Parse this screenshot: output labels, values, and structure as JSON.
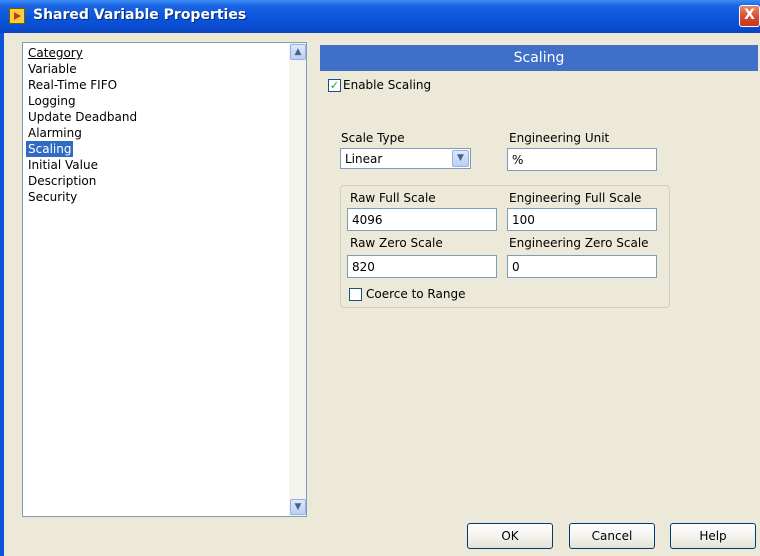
{
  "window": {
    "title": "Shared Variable Properties",
    "close_glyph": "X"
  },
  "category": {
    "header": "Category",
    "items": [
      "Variable",
      "Real-Time FIFO",
      "Logging",
      "Update Deadband",
      "Alarming",
      "Scaling",
      "Initial Value",
      "Description",
      "Security"
    ],
    "selected": "Scaling"
  },
  "scaling": {
    "section_title": "Scaling",
    "enable_label": "Enable Scaling",
    "enable_checked": true,
    "scale_type_label": "Scale Type",
    "scale_type_value": "Linear",
    "engineering_unit_label": "Engineering Unit",
    "engineering_unit_value": "%",
    "raw_full_label": "Raw Full Scale",
    "raw_full_value": "4096",
    "eng_full_label": "Engineering Full Scale",
    "eng_full_value": "100",
    "raw_zero_label": "Raw Zero Scale",
    "raw_zero_value": "820",
    "eng_zero_label": "Engineering Zero Scale",
    "eng_zero_value": "0",
    "coerce_label": "Coerce to Range",
    "coerce_checked": false
  },
  "buttons": {
    "ok": "OK",
    "cancel": "Cancel",
    "help": "Help"
  },
  "icons": {
    "app": "labview-app-icon",
    "close": "close-icon",
    "scroll_up": "scroll-up-arrow-icon",
    "scroll_down": "scroll-down-arrow-icon",
    "dropdown": "chevron-down-icon",
    "check": "checkmark-icon"
  },
  "colors": {
    "titlebar": "#0a55da",
    "section_header": "#3f6fc6",
    "selection": "#316ac5",
    "dialog_bg": "#ece9d8"
  }
}
